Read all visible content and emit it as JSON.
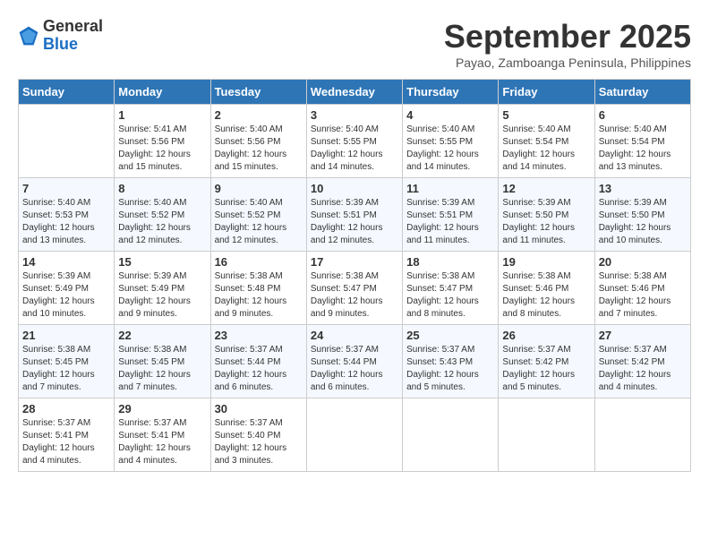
{
  "logo": {
    "general": "General",
    "blue": "Blue"
  },
  "title": "September 2025",
  "subtitle": "Payao, Zamboanga Peninsula, Philippines",
  "headers": [
    "Sunday",
    "Monday",
    "Tuesday",
    "Wednesday",
    "Thursday",
    "Friday",
    "Saturday"
  ],
  "weeks": [
    [
      {
        "day": "",
        "info": ""
      },
      {
        "day": "1",
        "info": "Sunrise: 5:41 AM\nSunset: 5:56 PM\nDaylight: 12 hours\nand 15 minutes."
      },
      {
        "day": "2",
        "info": "Sunrise: 5:40 AM\nSunset: 5:56 PM\nDaylight: 12 hours\nand 15 minutes."
      },
      {
        "day": "3",
        "info": "Sunrise: 5:40 AM\nSunset: 5:55 PM\nDaylight: 12 hours\nand 14 minutes."
      },
      {
        "day": "4",
        "info": "Sunrise: 5:40 AM\nSunset: 5:55 PM\nDaylight: 12 hours\nand 14 minutes."
      },
      {
        "day": "5",
        "info": "Sunrise: 5:40 AM\nSunset: 5:54 PM\nDaylight: 12 hours\nand 14 minutes."
      },
      {
        "day": "6",
        "info": "Sunrise: 5:40 AM\nSunset: 5:54 PM\nDaylight: 12 hours\nand 13 minutes."
      }
    ],
    [
      {
        "day": "7",
        "info": "Sunrise: 5:40 AM\nSunset: 5:53 PM\nDaylight: 12 hours\nand 13 minutes."
      },
      {
        "day": "8",
        "info": "Sunrise: 5:40 AM\nSunset: 5:52 PM\nDaylight: 12 hours\nand 12 minutes."
      },
      {
        "day": "9",
        "info": "Sunrise: 5:40 AM\nSunset: 5:52 PM\nDaylight: 12 hours\nand 12 minutes."
      },
      {
        "day": "10",
        "info": "Sunrise: 5:39 AM\nSunset: 5:51 PM\nDaylight: 12 hours\nand 12 minutes."
      },
      {
        "day": "11",
        "info": "Sunrise: 5:39 AM\nSunset: 5:51 PM\nDaylight: 12 hours\nand 11 minutes."
      },
      {
        "day": "12",
        "info": "Sunrise: 5:39 AM\nSunset: 5:50 PM\nDaylight: 12 hours\nand 11 minutes."
      },
      {
        "day": "13",
        "info": "Sunrise: 5:39 AM\nSunset: 5:50 PM\nDaylight: 12 hours\nand 10 minutes."
      }
    ],
    [
      {
        "day": "14",
        "info": "Sunrise: 5:39 AM\nSunset: 5:49 PM\nDaylight: 12 hours\nand 10 minutes."
      },
      {
        "day": "15",
        "info": "Sunrise: 5:39 AM\nSunset: 5:49 PM\nDaylight: 12 hours\nand 9 minutes."
      },
      {
        "day": "16",
        "info": "Sunrise: 5:38 AM\nSunset: 5:48 PM\nDaylight: 12 hours\nand 9 minutes."
      },
      {
        "day": "17",
        "info": "Sunrise: 5:38 AM\nSunset: 5:47 PM\nDaylight: 12 hours\nand 9 minutes."
      },
      {
        "day": "18",
        "info": "Sunrise: 5:38 AM\nSunset: 5:47 PM\nDaylight: 12 hours\nand 8 minutes."
      },
      {
        "day": "19",
        "info": "Sunrise: 5:38 AM\nSunset: 5:46 PM\nDaylight: 12 hours\nand 8 minutes."
      },
      {
        "day": "20",
        "info": "Sunrise: 5:38 AM\nSunset: 5:46 PM\nDaylight: 12 hours\nand 7 minutes."
      }
    ],
    [
      {
        "day": "21",
        "info": "Sunrise: 5:38 AM\nSunset: 5:45 PM\nDaylight: 12 hours\nand 7 minutes."
      },
      {
        "day": "22",
        "info": "Sunrise: 5:38 AM\nSunset: 5:45 PM\nDaylight: 12 hours\nand 7 minutes."
      },
      {
        "day": "23",
        "info": "Sunrise: 5:37 AM\nSunset: 5:44 PM\nDaylight: 12 hours\nand 6 minutes."
      },
      {
        "day": "24",
        "info": "Sunrise: 5:37 AM\nSunset: 5:44 PM\nDaylight: 12 hours\nand 6 minutes."
      },
      {
        "day": "25",
        "info": "Sunrise: 5:37 AM\nSunset: 5:43 PM\nDaylight: 12 hours\nand 5 minutes."
      },
      {
        "day": "26",
        "info": "Sunrise: 5:37 AM\nSunset: 5:42 PM\nDaylight: 12 hours\nand 5 minutes."
      },
      {
        "day": "27",
        "info": "Sunrise: 5:37 AM\nSunset: 5:42 PM\nDaylight: 12 hours\nand 4 minutes."
      }
    ],
    [
      {
        "day": "28",
        "info": "Sunrise: 5:37 AM\nSunset: 5:41 PM\nDaylight: 12 hours\nand 4 minutes."
      },
      {
        "day": "29",
        "info": "Sunrise: 5:37 AM\nSunset: 5:41 PM\nDaylight: 12 hours\nand 4 minutes."
      },
      {
        "day": "30",
        "info": "Sunrise: 5:37 AM\nSunset: 5:40 PM\nDaylight: 12 hours\nand 3 minutes."
      },
      {
        "day": "",
        "info": ""
      },
      {
        "day": "",
        "info": ""
      },
      {
        "day": "",
        "info": ""
      },
      {
        "day": "",
        "info": ""
      }
    ]
  ]
}
